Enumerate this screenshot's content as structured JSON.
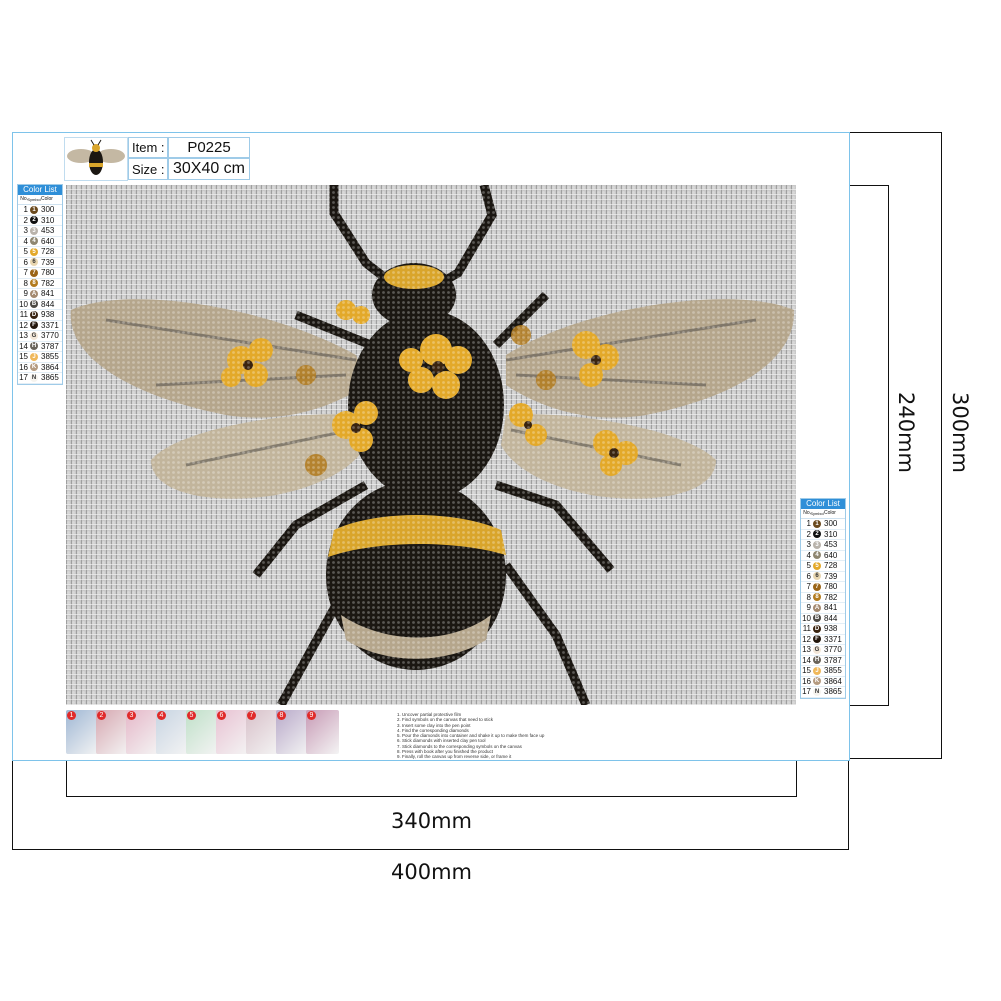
{
  "header": {
    "item_label": "Item :",
    "item_value": "P0225",
    "size_label": "Size :",
    "size_value": "30X40 cm"
  },
  "dimensions": {
    "inner_width": "340mm",
    "outer_width": "400mm",
    "inner_height": "240mm",
    "outer_height": "300mm"
  },
  "color_list": {
    "title": "Color List",
    "headers": [
      "No.",
      "Symbol",
      "Color"
    ],
    "rows": [
      {
        "no": "1",
        "sym": "1",
        "color": "300",
        "hex": "#6b4a1e"
      },
      {
        "no": "2",
        "sym": "2",
        "color": "310",
        "hex": "#111111"
      },
      {
        "no": "3",
        "sym": "3",
        "color": "453",
        "hex": "#b9b3ab"
      },
      {
        "no": "4",
        "sym": "4",
        "color": "640",
        "hex": "#8e8670"
      },
      {
        "no": "5",
        "sym": "5",
        "color": "728",
        "hex": "#e3a92a"
      },
      {
        "no": "6",
        "sym": "6",
        "color": "739",
        "hex": "#e8d6b0"
      },
      {
        "no": "7",
        "sym": "7",
        "color": "780",
        "hex": "#9a6416"
      },
      {
        "no": "8",
        "sym": "8",
        "color": "782",
        "hex": "#b27b1e"
      },
      {
        "no": "9",
        "sym": "A",
        "color": "841",
        "hex": "#a48a70"
      },
      {
        "no": "10",
        "sym": "B",
        "color": "844",
        "hex": "#4d4a44"
      },
      {
        "no": "11",
        "sym": "D",
        "color": "938",
        "hex": "#3a2410"
      },
      {
        "no": "12",
        "sym": "F",
        "color": "3371",
        "hex": "#24170c"
      },
      {
        "no": "13",
        "sym": "G",
        "color": "3770",
        "hex": "#f3e7d8"
      },
      {
        "no": "14",
        "sym": "H",
        "color": "3787",
        "hex": "#6a645a"
      },
      {
        "no": "15",
        "sym": "J",
        "color": "3855",
        "hex": "#f0b85a"
      },
      {
        "no": "16",
        "sym": "K",
        "color": "3864",
        "hex": "#b59b80"
      },
      {
        "no": "17",
        "sym": "N",
        "color": "3865",
        "hex": "#f5f3ee"
      }
    ]
  },
  "steps": {
    "numbers": [
      "1",
      "2",
      "3",
      "4",
      "5",
      "6",
      "7",
      "8",
      "9"
    ],
    "instructions": [
      "1. Uncover partial protective film",
      "2. Find symbols on the canvas that need to stick",
      "3. Insert some clay into the pen point",
      "4. Find the corresponding diamonds",
      "5. Pour the diamonds into container and shake it up to make them face up",
      "6. Stick diamonds with inserted clay pen tool",
      "7. Stick diamonds to the corresponding symbols on the canvas",
      "8. Press with book after you finished the product",
      "9. Finally, roll the canvas up from reverse side, or frame it"
    ]
  },
  "colors": {
    "bee_black": "#1b1712",
    "bee_yellow": "#d9a52b",
    "wing_tan": "#b5a68c",
    "frame_blue": "#7ec3ea"
  }
}
